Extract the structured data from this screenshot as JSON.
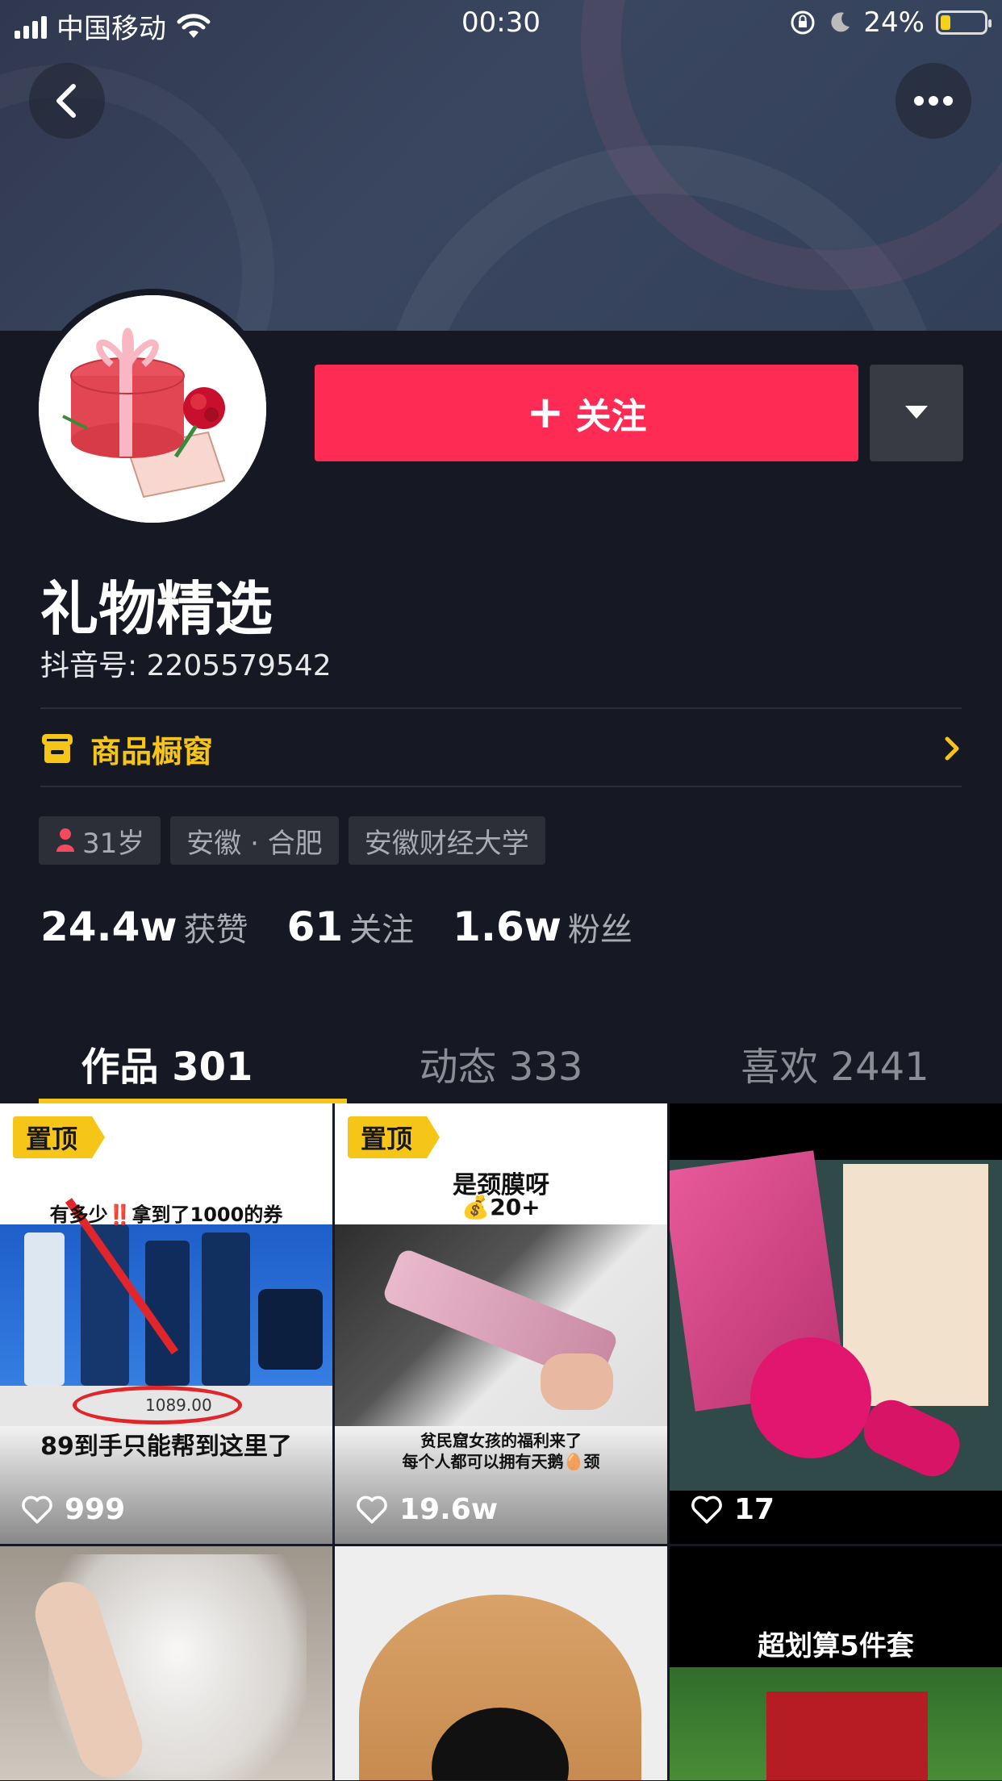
{
  "status_bar": {
    "carrier": "中国移动",
    "time": "00:30",
    "battery_percent": "24%",
    "battery_level": 0.24
  },
  "profile": {
    "name": "礼物精选",
    "douyin_id": "抖音号: 2205579542",
    "follow_label": "关注",
    "shop_label": "商品橱窗",
    "tags": {
      "age": "31岁",
      "location": "安徽 · 合肥",
      "school": "安徽财经大学"
    },
    "stats": [
      {
        "num": "24.4w",
        "label": "获赞"
      },
      {
        "num": "61",
        "label": "关注"
      },
      {
        "num": "1.6w",
        "label": "粉丝"
      }
    ]
  },
  "tabs": [
    {
      "label": "作品 301"
    },
    {
      "label": "动态 333"
    },
    {
      "label": "喜欢 2441"
    }
  ],
  "videos": [
    {
      "pinned_label": "置顶",
      "caption_top": "有多少‼️拿到了1000的券",
      "caption_bottom": "89到手只能帮到这里了",
      "price_tag": "1089.00",
      "likes": "999"
    },
    {
      "pinned_label": "置顶",
      "caption_top": "是颈膜呀",
      "caption_sub": "💰20+",
      "caption_bottom": "贫民窟女孩的福利来了",
      "caption_bottom2": "每个人都可以拥有天鹅🥚颈",
      "likes": "19.6w"
    },
    {
      "likes": "17"
    },
    {},
    {},
    {
      "caption_top": "超划算5件套"
    }
  ],
  "colors": {
    "background": "#161823",
    "follow": "#fe2c55",
    "accent": "#f5c518"
  }
}
